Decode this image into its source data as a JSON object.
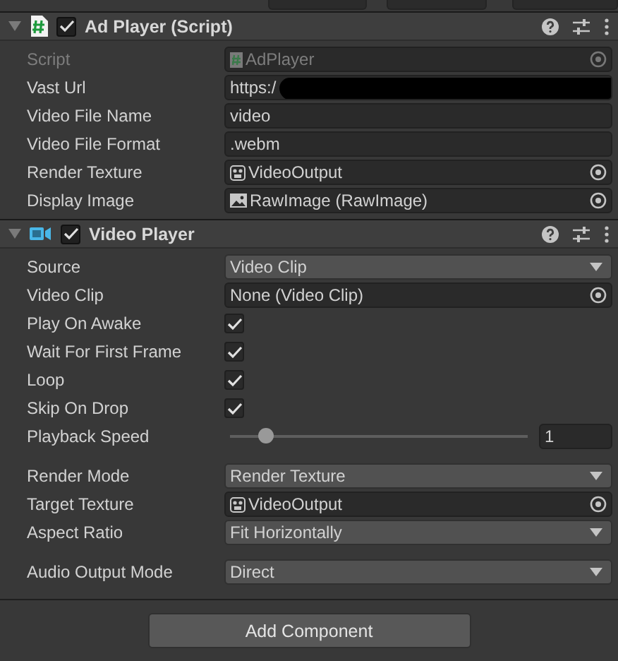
{
  "components": [
    {
      "title": "Ad Player (Script)",
      "kind": "script",
      "enabled": true,
      "expanded": true,
      "rows": [
        {
          "kind": "script-object",
          "label": "Script",
          "value": "AdPlayer",
          "disabled": true
        },
        {
          "kind": "text",
          "label": "Vast Url",
          "value": "https:/",
          "redacted": true
        },
        {
          "kind": "text",
          "label": "Video File Name",
          "value": "video"
        },
        {
          "kind": "text",
          "label": "Video File Format",
          "value": ".webm"
        },
        {
          "kind": "texture-object",
          "label": "Render Texture",
          "value": "VideoOutput"
        },
        {
          "kind": "image-object",
          "label": "Display Image",
          "value": "RawImage (RawImage)"
        }
      ]
    },
    {
      "title": "Video Player",
      "kind": "video",
      "enabled": true,
      "expanded": true,
      "rows": [
        {
          "kind": "dropdown",
          "label": "Source",
          "value": "Video Clip"
        },
        {
          "kind": "object",
          "label": "Video Clip",
          "value": "None (Video Clip)"
        },
        {
          "kind": "checkbox",
          "label": "Play On Awake",
          "checked": true
        },
        {
          "kind": "checkbox",
          "label": "Wait For First Frame",
          "checked": true
        },
        {
          "kind": "checkbox",
          "label": "Loop",
          "checked": true
        },
        {
          "kind": "checkbox",
          "label": "Skip On Drop",
          "checked": true
        },
        {
          "kind": "slider",
          "label": "Playback Speed",
          "level": 0.12,
          "value": "1"
        },
        {
          "kind": "space"
        },
        {
          "kind": "dropdown",
          "label": "Render Mode",
          "value": "Render Texture"
        },
        {
          "kind": "texture-object",
          "label": "Target Texture",
          "value": "VideoOutput"
        },
        {
          "kind": "dropdown",
          "label": "Aspect Ratio",
          "value": "Fit Horizontally"
        },
        {
          "kind": "space"
        },
        {
          "kind": "dropdown",
          "label": "Audio Output Mode",
          "value": "Direct"
        }
      ]
    }
  ],
  "add_button": "Add Component"
}
